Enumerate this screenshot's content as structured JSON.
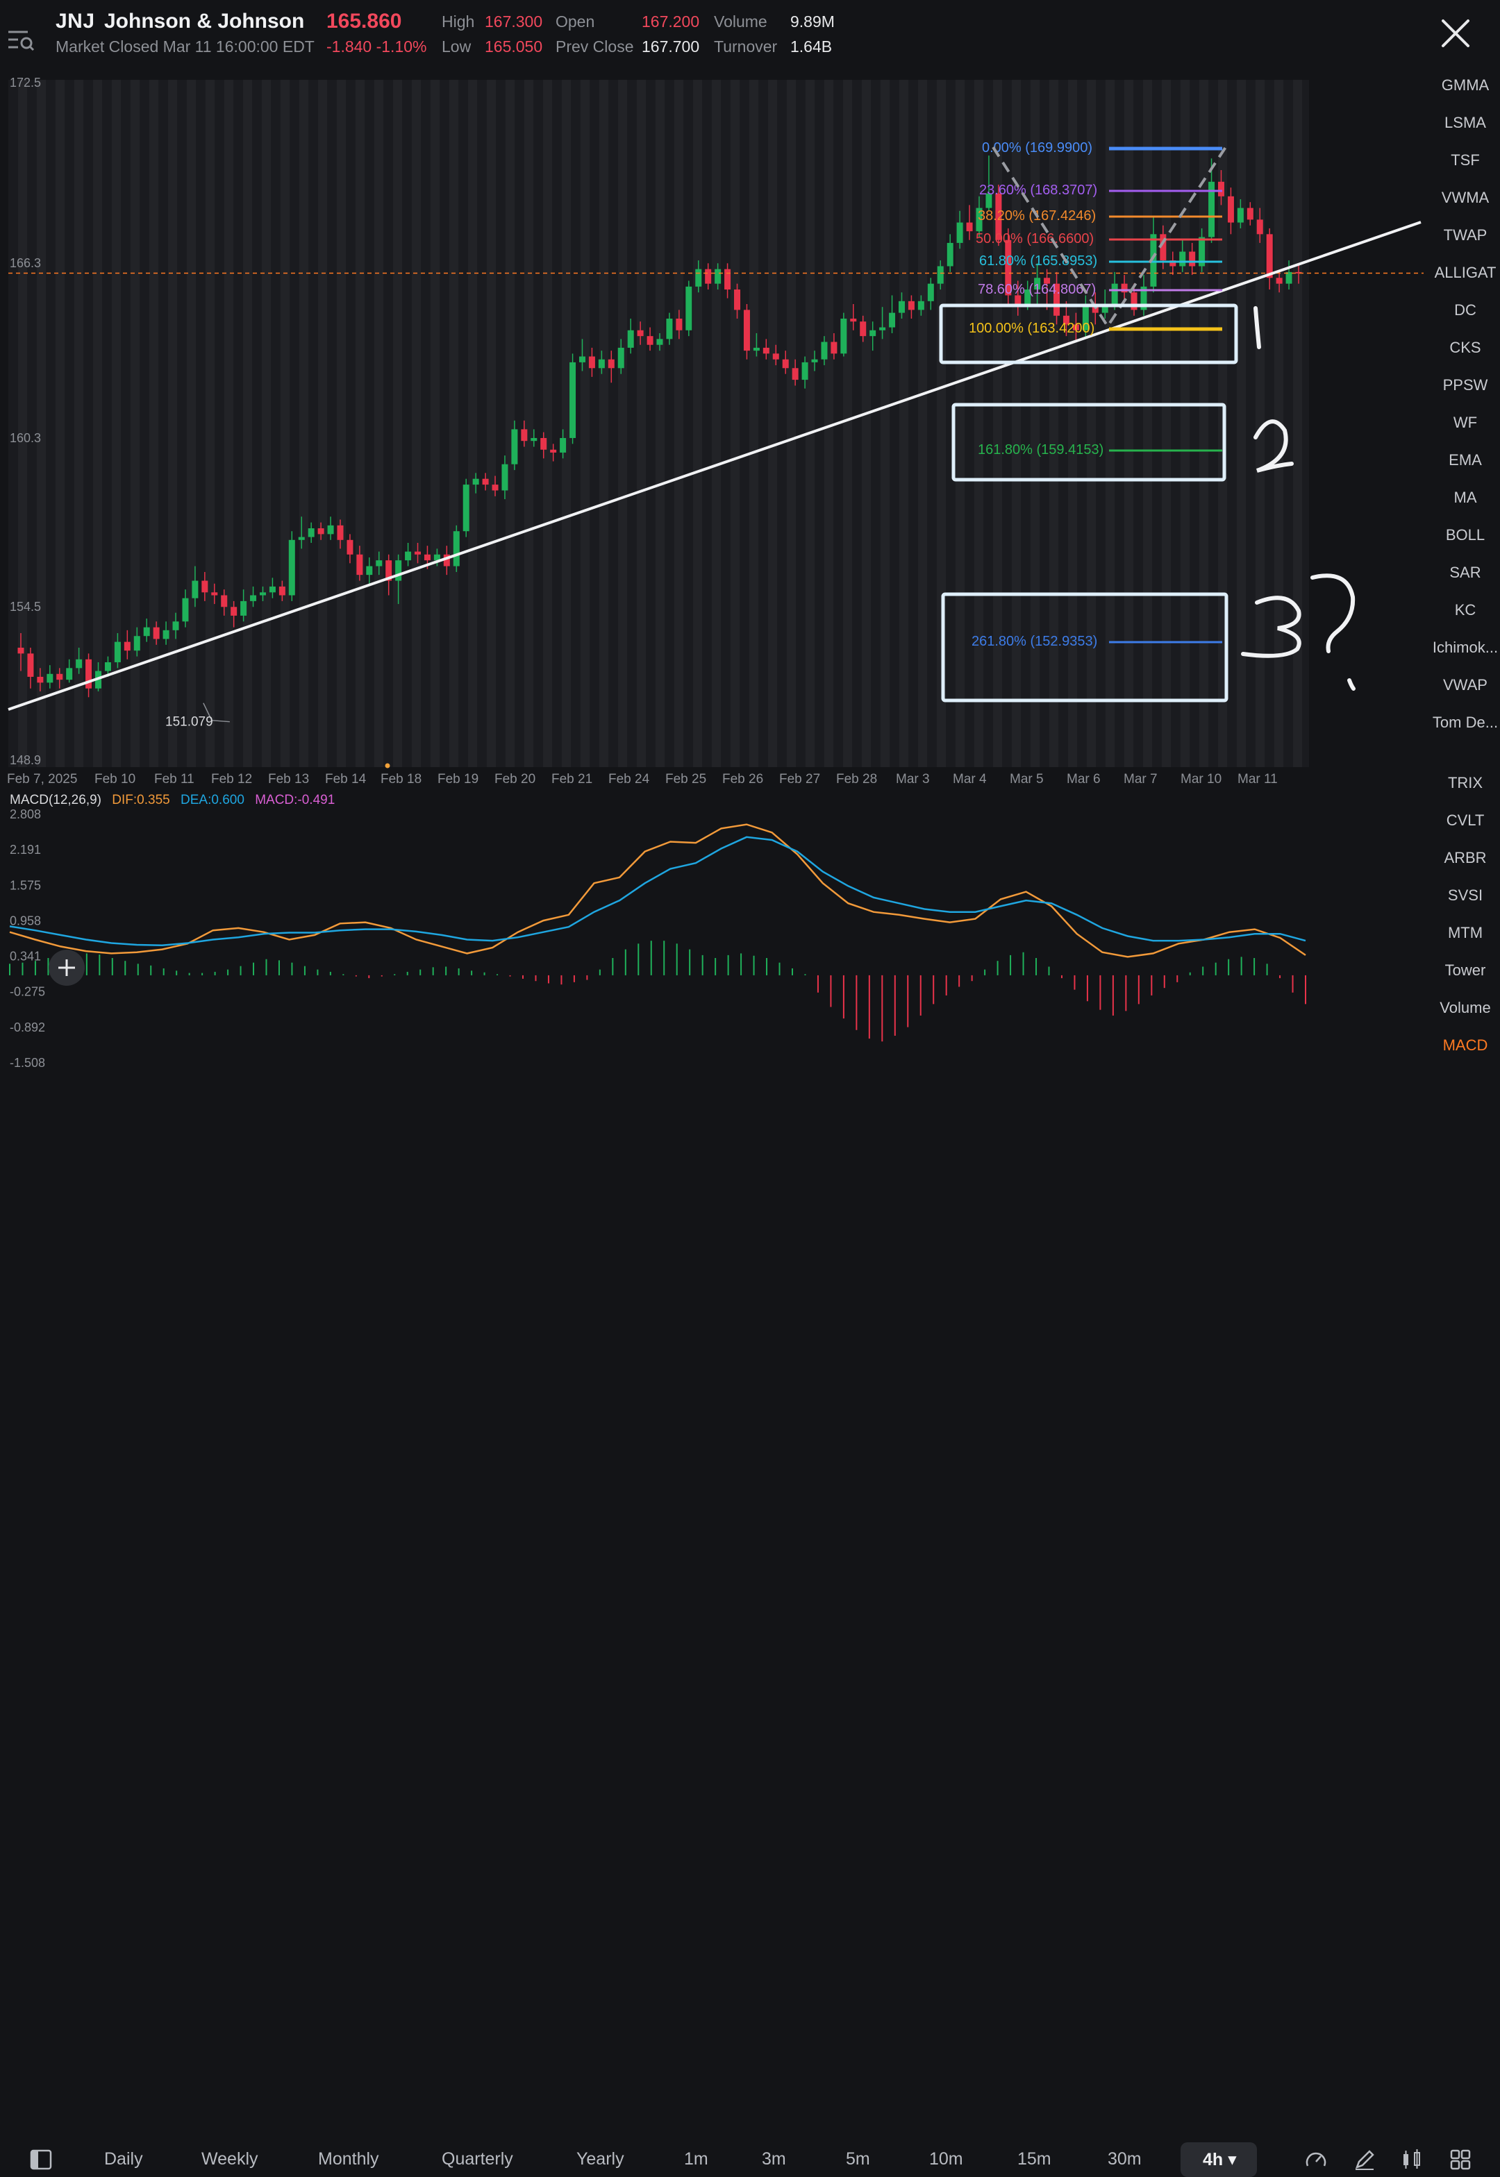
{
  "header": {
    "symbol": "JNJ",
    "name": "Johnson & Johnson",
    "price": "165.860",
    "market_status": "Market Closed Mar 11 16:00:00 EDT",
    "change": "-1.840 -1.10%",
    "stats": {
      "high_label": "High",
      "high": "167.300",
      "low_label": "Low",
      "low": "165.050",
      "open_label": "Open",
      "open": "167.200",
      "prev_close_label": "Prev Close",
      "prev_close": "167.700",
      "volume_label": "Volume",
      "volume": "9.89M",
      "turnover_label": "Turnover",
      "turnover": "1.64B"
    },
    "close_icon": "close-icon",
    "menu_icon": "search-menu-icon"
  },
  "indicators_top": [
    "GMMA",
    "LSMA",
    "TSF",
    "VWMA",
    "TWAP",
    "ALLIGAT",
    "DC",
    "CKS",
    "PPSW",
    "WF",
    "EMA",
    "MA",
    "BOLL",
    "SAR",
    "KC",
    "Ichimok...",
    "VWAP",
    "Tom De..."
  ],
  "indicators_bottom": [
    "TRIX",
    "CVLT",
    "ARBR",
    "SVSI",
    "MTM",
    "Tower",
    "Volume",
    "MACD"
  ],
  "active_indicator": "MACD",
  "macd_legend": {
    "title": "MACD(12,26,9)",
    "dif": "DIF:0.355",
    "dea": "DEA:0.600",
    "macd": "MACD:-0.491"
  },
  "annotations": {
    "low_price_label": "151.079",
    "handwritten": [
      "1",
      "2",
      "3",
      "?"
    ]
  },
  "fibonacci_levels": [
    {
      "label": "0.00% (169.9900)",
      "color": "#4a8cf7"
    },
    {
      "label": "23.60% (168.3707)",
      "color": "#a45ef0"
    },
    {
      "label": "38.20% (167.4246)",
      "color": "#f28a2c"
    },
    {
      "label": "50.00% (166.6600)",
      "color": "#e8434a"
    },
    {
      "label": "61.80% (165.8953)",
      "color": "#27c1de"
    },
    {
      "label": "78.60% (164.8067)",
      "color": "#c07be8"
    },
    {
      "label": "100.00% (163.4200)",
      "color": "#f4c21a"
    },
    {
      "label": "161.80% (159.4153)",
      "color": "#27b34d"
    },
    {
      "label": "261.80% (152.9353)",
      "color": "#3d7ce8"
    }
  ],
  "toolbar": {
    "items": [
      "Daily",
      "Weekly",
      "Monthly",
      "Quarterly",
      "Yearly",
      "1m",
      "3m",
      "5m",
      "10m",
      "15m",
      "30m"
    ],
    "selected": "4h",
    "icons": [
      "panel-toggle-icon",
      "speedometer-icon",
      "pen-draw-icon",
      "candlestick-type-icon",
      "grid-layout-icon"
    ]
  },
  "chart_data": [
    {
      "type": "candlestick",
      "title": "JNJ 4h",
      "y_ticks": [
        "172.5",
        "166.3",
        "160.3",
        "154.5",
        "148.9"
      ],
      "ylim": [
        148.9,
        172.5
      ],
      "x_labels": [
        "Feb 7, 2025",
        "Feb 10",
        "Feb 11",
        "Feb 12",
        "Feb 13",
        "Feb 14",
        "Feb 18",
        "Feb 19",
        "Feb 20",
        "Feb 21",
        "Feb 24",
        "Feb 25",
        "Feb 26",
        "Feb 27",
        "Feb 28",
        "Mar 3",
        "Mar 4",
        "Mar 5",
        "Mar 6",
        "Mar 7",
        "Mar 10",
        "Mar 11"
      ],
      "last_price_line": 165.86,
      "candles": [
        [
          153,
          152.8,
          153.5,
          152.2
        ],
        [
          152.8,
          152,
          153,
          151.6
        ],
        [
          152,
          151.8,
          152.3,
          151.5
        ],
        [
          151.8,
          152.1,
          152.4,
          151.6
        ],
        [
          152.1,
          151.9,
          152.3,
          151.6
        ],
        [
          151.9,
          152.3,
          152.6,
          151.8
        ],
        [
          152.3,
          152.6,
          153,
          152.1
        ],
        [
          152.6,
          151.6,
          152.8,
          151.3
        ],
        [
          151.6,
          152.2,
          152.5,
          151.5
        ],
        [
          152.2,
          152.5,
          152.7,
          152
        ],
        [
          152.5,
          153.2,
          153.5,
          152.3
        ],
        [
          153.2,
          152.9,
          153.6,
          152.6
        ],
        [
          152.9,
          153.4,
          153.7,
          152.7
        ],
        [
          153.4,
          153.7,
          154,
          153.2
        ],
        [
          153.7,
          153.3,
          153.9,
          153.1
        ],
        [
          153.3,
          153.6,
          153.9,
          153.1
        ],
        [
          153.6,
          153.9,
          154.2,
          153.3
        ],
        [
          153.9,
          154.7,
          155,
          153.7
        ],
        [
          154.7,
          155.3,
          155.8,
          154.4
        ],
        [
          155.3,
          154.9,
          155.6,
          154.6
        ],
        [
          154.9,
          154.8,
          155.2,
          154.5
        ],
        [
          154.8,
          154.4,
          155,
          154.1
        ],
        [
          154.4,
          154.1,
          154.6,
          153.7
        ],
        [
          154.1,
          154.6,
          155,
          153.9
        ],
        [
          154.6,
          154.8,
          155.1,
          154.4
        ],
        [
          154.8,
          154.9,
          155.1,
          154.6
        ],
        [
          154.9,
          155.1,
          155.4,
          154.7
        ],
        [
          155.1,
          154.8,
          155.3,
          154.6
        ],
        [
          154.8,
          156.7,
          157,
          154.6
        ],
        [
          156.7,
          156.8,
          157.5,
          156.4
        ],
        [
          156.8,
          157.1,
          157.3,
          156.6
        ],
        [
          157.1,
          156.9,
          157.3,
          156.7
        ],
        [
          156.9,
          157.2,
          157.5,
          156.7
        ],
        [
          157.2,
          156.7,
          157.4,
          156.4
        ],
        [
          156.7,
          156.2,
          156.9,
          155.9
        ],
        [
          156.2,
          155.5,
          156.5,
          155.3
        ],
        [
          155.5,
          155.8,
          156.1,
          155.2
        ],
        [
          155.8,
          156,
          156.3,
          155.5
        ],
        [
          156,
          155.3,
          156.2,
          154.8
        ],
        [
          155.3,
          156,
          156.2,
          154.5
        ],
        [
          156,
          156.3,
          156.6,
          155.8
        ],
        [
          156.3,
          156.2,
          156.6,
          155.9
        ],
        [
          156.2,
          156,
          156.5,
          155.7
        ],
        [
          156,
          156.2,
          156.4,
          155.8
        ],
        [
          156.2,
          155.8,
          156.5,
          155.5
        ],
        [
          155.8,
          157,
          157.2,
          155.6
        ],
        [
          157,
          158.6,
          158.8,
          156.8
        ],
        [
          158.6,
          158.8,
          159,
          158.3
        ],
        [
          158.8,
          158.6,
          159,
          158.4
        ],
        [
          158.6,
          158.4,
          158.9,
          158.2
        ],
        [
          158.4,
          159.3,
          159.6,
          158.1
        ],
        [
          159.3,
          160.5,
          160.8,
          159.1
        ],
        [
          160.5,
          160.1,
          160.8,
          159.9
        ],
        [
          160.1,
          160.2,
          160.5,
          159.9
        ],
        [
          160.2,
          159.8,
          160.4,
          159.5
        ],
        [
          159.8,
          159.7,
          160,
          159.4
        ],
        [
          159.7,
          160.2,
          160.5,
          159.5
        ],
        [
          160.2,
          162.8,
          163.1,
          160
        ],
        [
          162.8,
          163,
          163.6,
          162.5
        ],
        [
          163,
          162.6,
          163.3,
          162.3
        ],
        [
          162.6,
          162.9,
          163.2,
          162.4
        ],
        [
          162.9,
          162.6,
          163.2,
          162.1
        ],
        [
          162.6,
          163.3,
          163.6,
          162.4
        ],
        [
          163.3,
          163.9,
          164.3,
          163.1
        ],
        [
          163.9,
          163.7,
          164.2,
          163.4
        ],
        [
          163.7,
          163.4,
          164,
          163.2
        ],
        [
          163.4,
          163.6,
          163.8,
          163.2
        ],
        [
          163.6,
          164.3,
          164.5,
          163.4
        ],
        [
          164.3,
          163.9,
          164.6,
          163.6
        ],
        [
          163.9,
          165.4,
          165.6,
          163.7
        ],
        [
          165.4,
          166,
          166.3,
          165.2
        ],
        [
          166,
          165.5,
          166.2,
          165.3
        ],
        [
          165.5,
          166,
          166.2,
          165.3
        ],
        [
          166,
          165.3,
          166.2,
          165
        ],
        [
          165.3,
          164.6,
          165.5,
          164.3
        ],
        [
          164.6,
          163.2,
          164.8,
          162.9
        ],
        [
          163.2,
          163.3,
          163.8,
          163
        ],
        [
          163.3,
          163.1,
          163.6,
          162.9
        ],
        [
          163.1,
          162.9,
          163.4,
          162.7
        ],
        [
          162.9,
          162.6,
          163.2,
          162.4
        ],
        [
          162.6,
          162.2,
          162.9,
          162
        ],
        [
          162.2,
          162.8,
          163,
          161.9
        ],
        [
          162.8,
          162.9,
          163.2,
          162.5
        ],
        [
          162.9,
          163.5,
          163.7,
          162.7
        ],
        [
          163.5,
          163.1,
          163.8,
          162.9
        ],
        [
          163.1,
          164.3,
          164.5,
          163
        ],
        [
          164.3,
          164.2,
          164.8,
          163.9
        ],
        [
          164.2,
          163.7,
          164.4,
          163.5
        ],
        [
          163.7,
          163.9,
          164.2,
          163.2
        ],
        [
          163.9,
          164,
          164.7,
          163.6
        ],
        [
          164,
          164.5,
          165.1,
          163.8
        ],
        [
          164.5,
          164.9,
          165.2,
          164.3
        ],
        [
          164.9,
          164.6,
          165.1,
          164.3
        ],
        [
          164.6,
          164.9,
          165.1,
          164.4
        ],
        [
          164.9,
          165.5,
          165.7,
          164.6
        ],
        [
          165.5,
          166.1,
          166.3,
          165.3
        ],
        [
          166.1,
          166.9,
          167.2,
          165.9
        ],
        [
          166.9,
          167.6,
          168,
          166.7
        ],
        [
          167.6,
          167.3,
          168.2,
          167
        ],
        [
          167.3,
          168.1,
          168.5,
          167.1
        ],
        [
          168.1,
          168.6,
          169.9,
          168
        ],
        [
          168.6,
          167,
          168.9,
          166.8
        ],
        [
          167,
          165.1,
          167.4,
          164.7
        ],
        [
          165.1,
          164.8,
          165.6,
          164.4
        ],
        [
          164.8,
          165.3,
          165.6,
          164.6
        ],
        [
          165.3,
          165.7,
          166.2,
          164.8
        ],
        [
          165.7,
          165.5,
          166,
          164.6
        ],
        [
          165.5,
          164.4,
          165.9,
          164.1
        ],
        [
          164.4,
          164.1,
          164.9,
          163.7
        ],
        [
          164.1,
          163.9,
          164.5,
          163.5
        ],
        [
          163.9,
          164.8,
          165.1,
          163.6
        ],
        [
          164.8,
          164.5,
          165.2,
          164.1
        ],
        [
          164.5,
          164.8,
          165.3,
          164.3
        ],
        [
          164.8,
          165.5,
          165.9,
          164.6
        ],
        [
          165.5,
          165.2,
          165.8,
          164.9
        ],
        [
          165.2,
          164.6,
          165.5,
          164.4
        ],
        [
          164.6,
          165.4,
          165.8,
          164.4
        ],
        [
          165.4,
          167.2,
          167.8,
          165.2
        ],
        [
          167.2,
          166.3,
          167.5,
          166
        ],
        [
          166.3,
          166.1,
          166.6,
          165.8
        ],
        [
          166.1,
          166.6,
          167,
          165.9
        ],
        [
          166.6,
          166.1,
          166.9,
          165.8
        ],
        [
          166.1,
          167.1,
          167.4,
          165.9
        ],
        [
          167.1,
          169,
          169.8,
          166.9
        ],
        [
          169,
          168.5,
          169.4,
          168.2
        ],
        [
          168.5,
          167.6,
          168.8,
          167.2
        ],
        [
          167.6,
          168.1,
          168.4,
          167.4
        ],
        [
          168.1,
          167.7,
          168.3,
          167.5
        ],
        [
          167.7,
          167.2,
          168.1,
          166.9
        ],
        [
          167.2,
          165.7,
          167.4,
          165.3
        ],
        [
          165.7,
          165.5,
          165.9,
          165.2
        ],
        [
          165.5,
          165.9,
          166.3,
          165.3
        ],
        [
          165.9,
          165.86,
          166.2,
          165.5
        ]
      ]
    },
    {
      "type": "line",
      "title": "MACD(12,26,9)",
      "y_ticks": [
        "2.808",
        "2.191",
        "1.575",
        "0.958",
        "0.341",
        "-0.275",
        "-0.892",
        "-1.508"
      ],
      "ylim": [
        -1.508,
        2.808
      ],
      "series": [
        {
          "name": "DIF",
          "color": "#f29a3a",
          "values": [
            0.75,
            0.62,
            0.5,
            0.42,
            0.38,
            0.4,
            0.45,
            0.55,
            0.78,
            0.82,
            0.75,
            0.62,
            0.7,
            0.9,
            0.92,
            0.82,
            0.62,
            0.5,
            0.38,
            0.48,
            0.75,
            0.95,
            1.05,
            1.6,
            1.7,
            2.15,
            2.32,
            2.3,
            2.55,
            2.62,
            2.48,
            2.1,
            1.6,
            1.25,
            1.1,
            1.05,
            0.98,
            0.92,
            0.98,
            1.32,
            1.45,
            1.2,
            0.72,
            0.4,
            0.32,
            0.38,
            0.55,
            0.62,
            0.75,
            0.8,
            0.65,
            0.35
          ]
        },
        {
          "name": "DEA",
          "color": "#1fa6e0",
          "values": [
            0.85,
            0.78,
            0.7,
            0.62,
            0.56,
            0.53,
            0.52,
            0.56,
            0.62,
            0.66,
            0.72,
            0.74,
            0.74,
            0.78,
            0.8,
            0.8,
            0.76,
            0.7,
            0.62,
            0.6,
            0.66,
            0.75,
            0.84,
            1.1,
            1.3,
            1.6,
            1.85,
            1.95,
            2.2,
            2.4,
            2.35,
            2.15,
            1.8,
            1.55,
            1.35,
            1.25,
            1.15,
            1.1,
            1.1,
            1.2,
            1.3,
            1.25,
            1.05,
            0.82,
            0.68,
            0.6,
            0.6,
            0.62,
            0.66,
            0.72,
            0.72,
            0.6
          ]
        }
      ],
      "histogram": [
        0.2,
        0.22,
        0.25,
        0.3,
        0.35,
        0.4,
        0.38,
        0.36,
        0.3,
        0.25,
        0.2,
        0.17,
        0.12,
        0.08,
        0.04,
        0.04,
        0.06,
        0.1,
        0.16,
        0.22,
        0.28,
        0.26,
        0.22,
        0.16,
        0.1,
        0.06,
        0.02,
        -0.02,
        -0.05,
        -0.02,
        0.02,
        0.06,
        0.1,
        0.14,
        0.15,
        0.12,
        0.08,
        0.05,
        0.02,
        -0.02,
        -0.06,
        -0.1,
        -0.14,
        -0.16,
        -0.12,
        -0.08,
        0.1,
        0.3,
        0.45,
        0.55,
        0.6,
        0.6,
        0.55,
        0.45,
        0.35,
        0.3,
        0.35,
        0.38,
        0.34,
        0.3,
        0.22,
        0.12,
        0.02,
        -0.3,
        -0.55,
        -0.75,
        -0.95,
        -1.1,
        -1.15,
        -1.05,
        -0.9,
        -0.7,
        -0.5,
        -0.35,
        -0.2,
        -0.1,
        0.1,
        0.25,
        0.35,
        0.4,
        0.3,
        0.15,
        -0.05,
        -0.25,
        -0.45,
        -0.6,
        -0.7,
        -0.62,
        -0.5,
        -0.35,
        -0.22,
        -0.12,
        0.05,
        0.15,
        0.22,
        0.28,
        0.32,
        0.3,
        0.2,
        -0.05,
        -0.3,
        -0.5
      ]
    }
  ]
}
